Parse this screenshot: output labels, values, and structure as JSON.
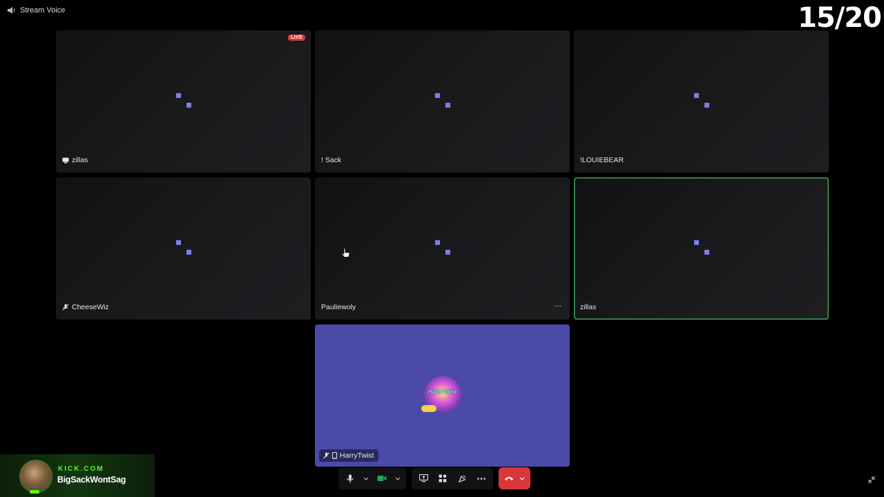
{
  "channel": {
    "name": "Stream Voice"
  },
  "counter": "15/20",
  "tiles": [
    {
      "name": "zillas",
      "badge": "LIVE"
    },
    {
      "name": "! Sack"
    },
    {
      "name": "!LOUIEBEAR"
    },
    {
      "name": "CheeseWiz"
    },
    {
      "name": "Pauliewoly"
    },
    {
      "name": "zillas"
    }
  ],
  "featured": {
    "name": "HarryTwist",
    "avatar_text": "HarryTwist"
  },
  "toolbar": {
    "mic": "microphone-icon",
    "camera": "camera-icon",
    "share": "screen-share-icon",
    "activities": "activities-icon",
    "soundboard": "soundboard-icon",
    "more": "more-icon",
    "disconnect": "phone-hangup-icon"
  },
  "kick_overlay": {
    "site": "KICK.COM",
    "channel": "BigSackWontSag"
  },
  "colors": {
    "loader": "#7b7ff0",
    "speaking": "#3ba55c",
    "featured_bg": "#4b4aa8",
    "hangup": "#da373c",
    "kick_green": "#53fc18"
  }
}
